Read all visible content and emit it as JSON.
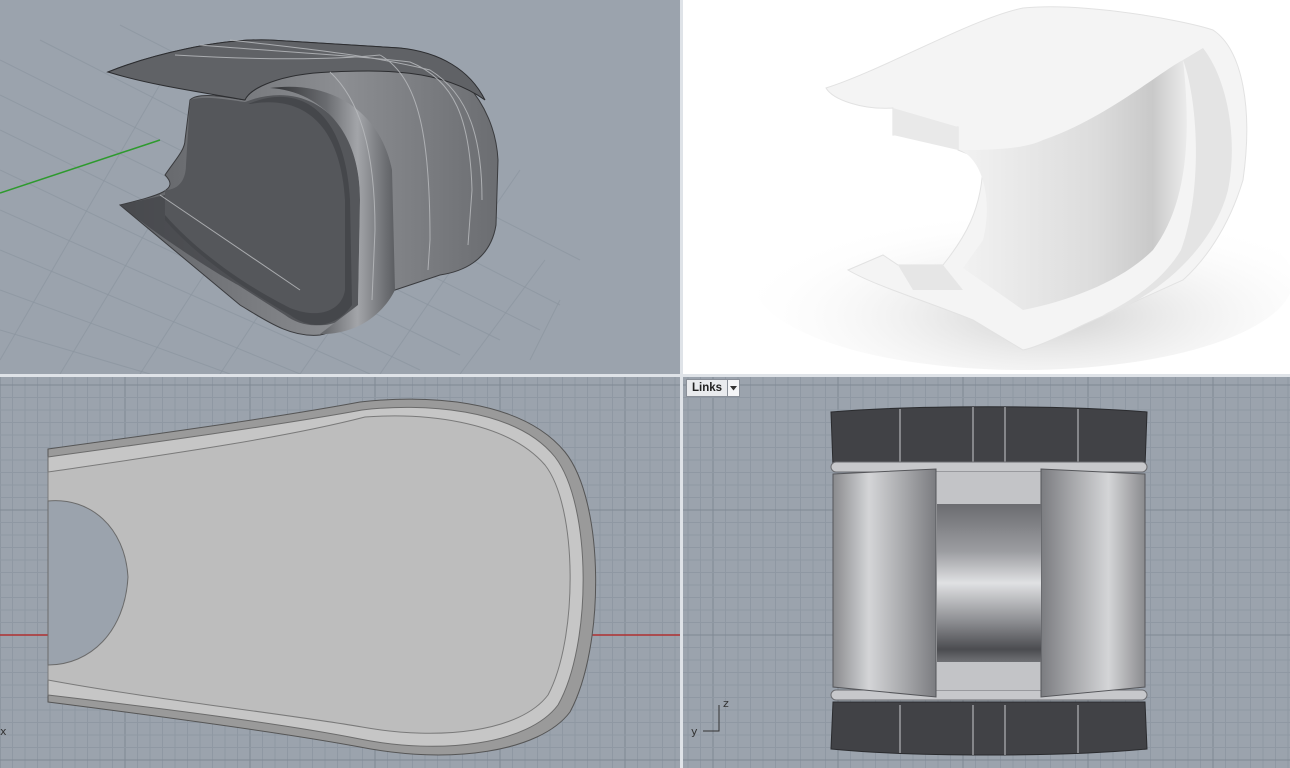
{
  "viewports": {
    "perspective": {
      "label": ""
    },
    "rendered": {
      "label": ""
    },
    "top": {
      "label": "",
      "axis_x": "x"
    },
    "left": {
      "label": "Links",
      "dropdown_icon": "triangle-down-icon",
      "axis_y": "y",
      "axis_z": "z"
    }
  },
  "colors": {
    "viewport_bg": "#9ba3ad",
    "grid_minor": "#8f98a3",
    "grid_major": "#7f8894",
    "axis_x": "#b03030",
    "axis_y": "#2e9a2e",
    "shaded_surface": "#4a4c50",
    "rendered_bg": "#ffffff",
    "top_fill": "#bdbdbd"
  }
}
